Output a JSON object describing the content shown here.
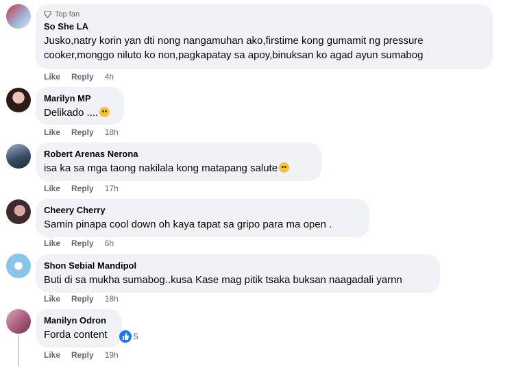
{
  "comments": [
    {
      "badge": "Top fan",
      "author": "So She LA",
      "text": "Jusko,natry korin yan dti nong nangamuhan ako,firstime kong gumamit ng pressure cooker,monggo niluto ko non,pagkapatay sa apoy,binuksan ko agad ayun sumabog",
      "like": "Like",
      "reply": "Reply",
      "time": "4h",
      "avatar_colors": [
        "#c9354d",
        "#9db7d9"
      ]
    },
    {
      "author": "Marilyn MP",
      "text": "Delikado ....",
      "emoji": "sad-face-emoji",
      "like": "Like",
      "reply": "Reply",
      "time": "18h",
      "avatar_colors": [
        "#2b1b16",
        "#e7c6b4"
      ]
    },
    {
      "author": "Robert Arenas Nerona",
      "text": "isa ka sa mga taong nakilala kong matapang salute",
      "emoji": "saluting-face-emoji",
      "like": "Like",
      "reply": "Reply",
      "time": "17h",
      "avatar_colors": [
        "#3a4b63",
        "#9fb1c7"
      ]
    },
    {
      "author": "Cheery Cherry",
      "text": "Samin pinapa cool down oh kaya tapat sa gripo para ma open .",
      "like": "Like",
      "reply": "Reply",
      "time": "6h",
      "avatar_colors": [
        "#3b2a2e",
        "#d8a9a3"
      ]
    },
    {
      "author": "Shon Sebial Mandipol",
      "text": "Buti di sa mukha sumabog..kusa Kase mag pitik tsaka buksan naagadali yarnn",
      "like": "Like",
      "reply": "Reply",
      "time": "18h",
      "avatar_colors": [
        "#89c5e6",
        "#ffffff"
      ]
    },
    {
      "author": "Manilyn Odron",
      "text": "Forda content",
      "reaction_count": "5",
      "like": "Like",
      "reply": "Reply",
      "time": "19h",
      "avatar_colors": [
        "#a85b7a",
        "#d9a8bd"
      ]
    }
  ],
  "colors": {
    "bubble": "#f0f2f5",
    "meta": "#65676b",
    "like_blue": "#1877f2"
  }
}
